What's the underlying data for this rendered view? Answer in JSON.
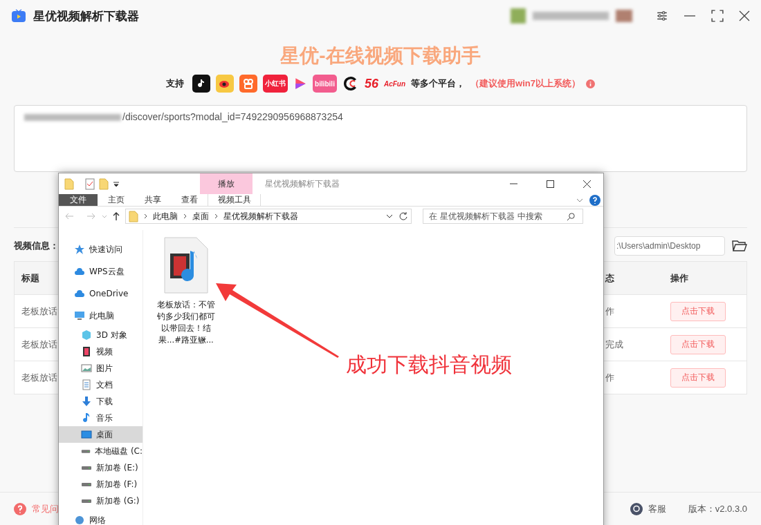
{
  "app": {
    "title": "星优视频解析下载器",
    "heading": "星优-在线视频下载助手",
    "support_label": "支持",
    "platforms": [
      {
        "kind": "note",
        "color": "#111111"
      },
      {
        "kind": "eye",
        "color": "#f7c843"
      },
      {
        "kind": "camera",
        "color": "#ff6a2b"
      },
      {
        "kind": "tile",
        "color": "#f0223c",
        "mark": "小红书"
      },
      {
        "kind": "play",
        "color": "#ff4d6a"
      },
      {
        "kind": "tile",
        "color": "#f25d8e",
        "mark": "bilibili"
      },
      {
        "kind": "ring",
        "color": "#111111"
      },
      {
        "kind": "word",
        "color": "#e8202a",
        "mark": "56"
      },
      {
        "kind": "word",
        "color": "#e8202a",
        "mark": "AcFun"
      }
    ],
    "platform_note": "等多个平台，",
    "warning": "（建议使用win7以上系统）",
    "url_value": "/discover/sports?modal_id=7492290956968873254",
    "info_label": "视频信息：",
    "save_path": ":\\Users\\admin\\Desktop",
    "table": {
      "columns": [
        "标题",
        "态",
        "操作"
      ],
      "rows": [
        {
          "title": "老板放话",
          "status": "作",
          "action": "点击下载"
        },
        {
          "title": "老板放话",
          "status": "完成",
          "action": "点击下载"
        },
        {
          "title": "老板放话",
          "status": "作",
          "action": "点击下载"
        }
      ]
    },
    "footer": {
      "help": "常见问",
      "service": "客服",
      "version": "版本：v2.0.3.0"
    }
  },
  "explorer": {
    "context_tab": "播放",
    "title": "星优视频解析下载器",
    "ribbon_tabs": [
      {
        "label": "文件",
        "selected": true
      },
      {
        "label": "主页",
        "selected": false
      },
      {
        "label": "共享",
        "selected": false
      },
      {
        "label": "查看",
        "selected": false
      },
      {
        "label": "视频工具",
        "selected": false
      }
    ],
    "breadcrumbs": [
      "此电脑",
      "桌面",
      "星优视频解析下载器"
    ],
    "search": {
      "placeholder": "在 星优视频解析下载器 中搜索"
    },
    "nav": [
      {
        "label": "快速访问",
        "kind": "star",
        "selected": false
      },
      {
        "label": "WPS云盘",
        "kind": "cloud",
        "selected": false
      },
      {
        "label": "OneDrive",
        "kind": "cloud",
        "selected": false
      },
      {
        "label": "此电脑",
        "kind": "pc",
        "selected": false,
        "children": [
          {
            "label": "3D 对象",
            "kind": "cube",
            "selected": false
          },
          {
            "label": "视频",
            "kind": "film",
            "selected": false
          },
          {
            "label": "图片",
            "kind": "picture",
            "selected": false
          },
          {
            "label": "文档",
            "kind": "doc",
            "selected": false
          },
          {
            "label": "下载",
            "kind": "down",
            "selected": false
          },
          {
            "label": "音乐",
            "kind": "music",
            "selected": false
          },
          {
            "label": "桌面",
            "kind": "desktop",
            "selected": true
          },
          {
            "label": "本地磁盘 (C:",
            "kind": "drive",
            "selected": false
          },
          {
            "label": "新加卷 (E:)",
            "kind": "drive",
            "selected": false
          },
          {
            "label": "新加卷 (F:)",
            "kind": "drive",
            "selected": false
          },
          {
            "label": "新加卷 (G:)",
            "kind": "drive",
            "selected": false
          }
        ]
      },
      {
        "label": "网络",
        "kind": "globe",
        "selected": false
      }
    ],
    "files": [
      {
        "name": "老板放话：不管钓多少我们都可以带回去！结果...#路亚鳜..."
      }
    ]
  },
  "annotation": {
    "text": "成功下载抖音视频"
  }
}
